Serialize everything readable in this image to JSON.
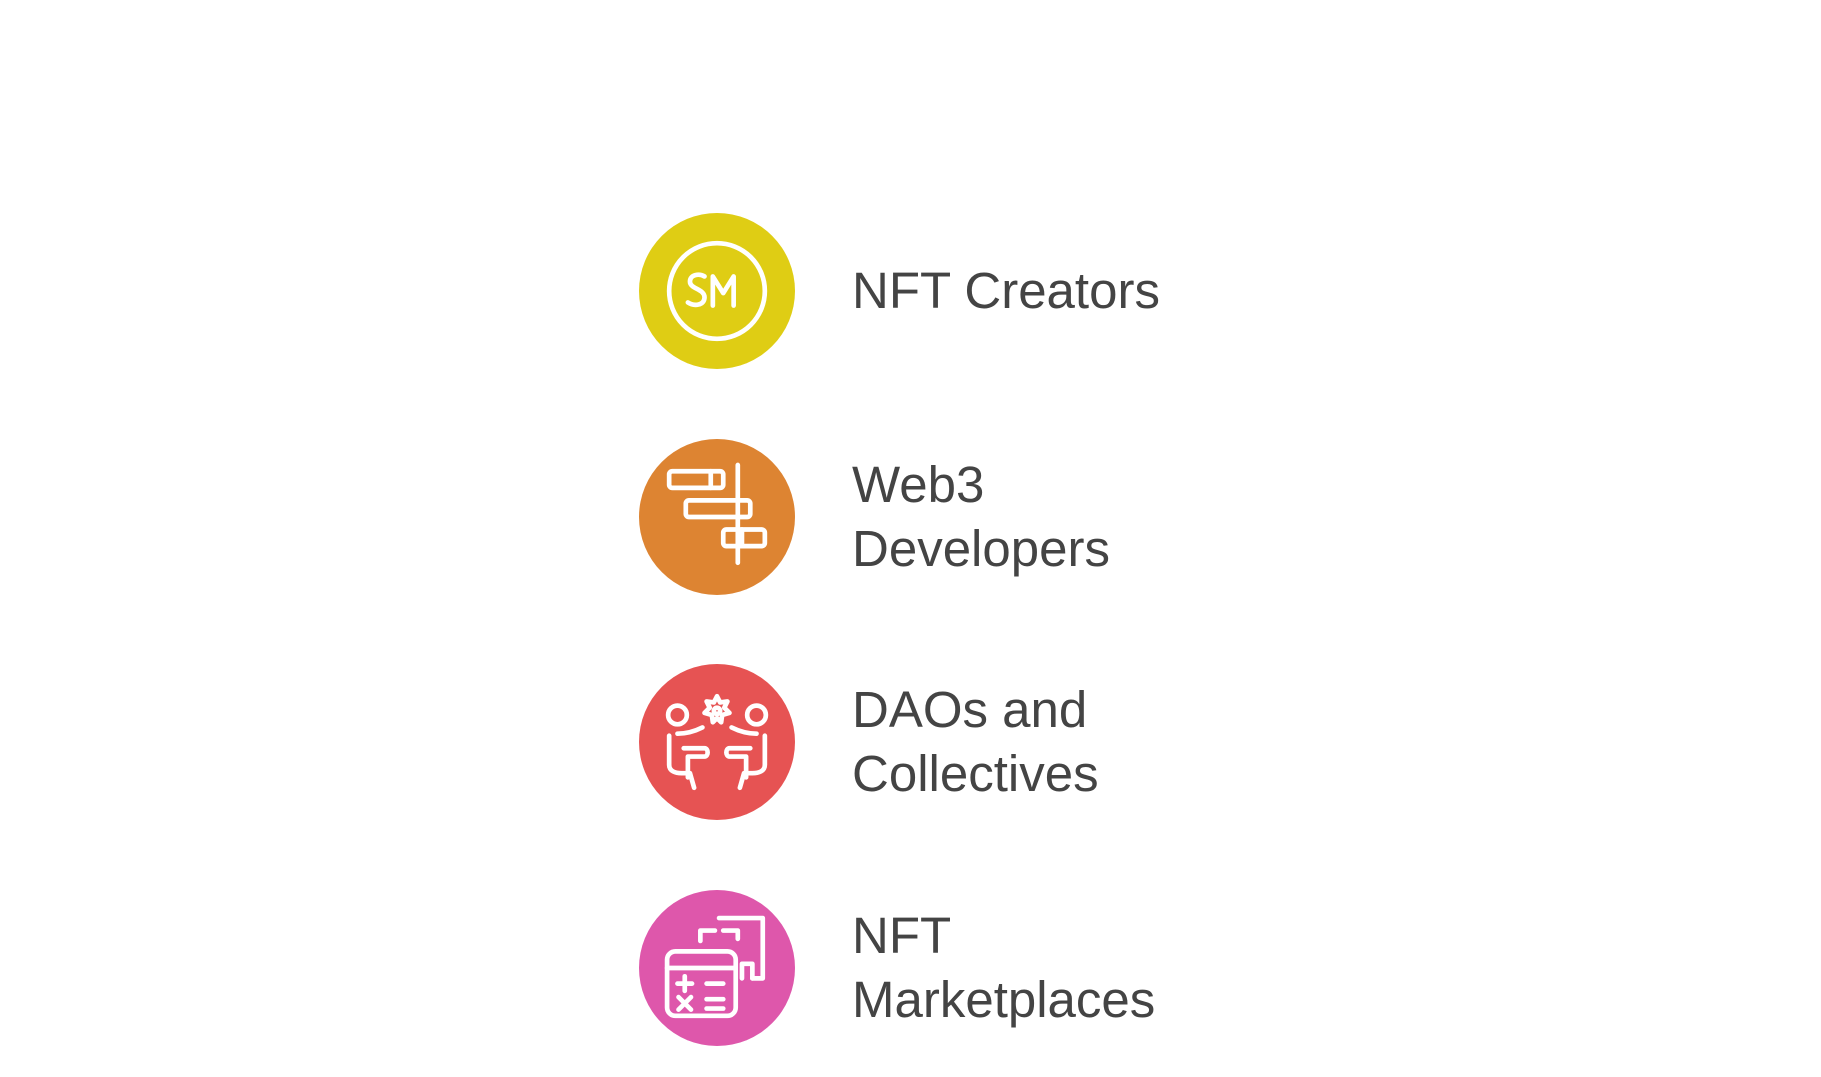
{
  "items": [
    {
      "label": "NFT Creators",
      "icon": "sm-coin-icon",
      "color": "#dfcd14"
    },
    {
      "label": "Web3\nDevelopers",
      "icon": "gantt-chart-icon",
      "color": "#dd8432"
    },
    {
      "label": "DAOs and\nCollectives",
      "icon": "collaboration-icon",
      "color": "#e65353"
    },
    {
      "label": "NFT\nMarketplaces",
      "icon": "calculator-document-icon",
      "color": "#de57ab"
    }
  ]
}
